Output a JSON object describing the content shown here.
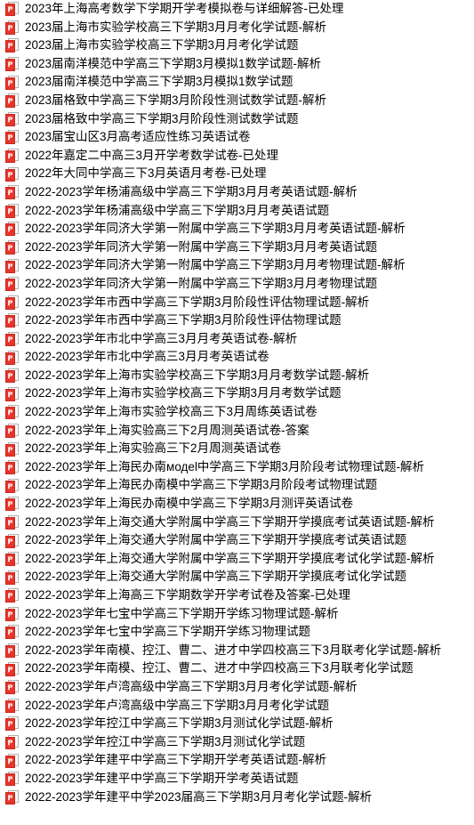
{
  "page": {
    "background_color": "#ffffff",
    "text_color": "#000000",
    "icon_color": "#e8342a",
    "icon_outline_color": "#a8a8a8",
    "icon_name": "pdf-document-icon"
  },
  "file_list": {
    "items": [
      {
        "label": "2023年上海高考数学下学期开学考模拟卷与详细解答-已处理"
      },
      {
        "label": "2023届上海市实验学校高三下学期3月月考化学试题-解析"
      },
      {
        "label": "2023届上海市实验学校高三下学期3月月考化学试题"
      },
      {
        "label": "2023届南洋模范中学高三下学期3月模拟1数学试题-解析"
      },
      {
        "label": "2023届南洋模范中学高三下学期3月模拟1数学试题"
      },
      {
        "label": "2023届格致中学高三下学期3月阶段性测试数学试题-解析"
      },
      {
        "label": "2023届格致中学高三下学期3月阶段性测试数学试题"
      },
      {
        "label": "2023届宝山区3月高考适应性练习英语试卷"
      },
      {
        "label": "2022年嘉定二中高三3月开学考数学试卷-已处理"
      },
      {
        "label": "2022年大同中学高三下3月英语月考卷-已处理"
      },
      {
        "label": "2022-2023学年杨浦高级中学高三下学期3月月考英语试题-解析"
      },
      {
        "label": "2022-2023学年杨浦高级中学高三下学期3月月考英语试题"
      },
      {
        "label": "2022-2023学年同济大学第一附属中学高三下学期3月月考英语试题-解析"
      },
      {
        "label": "2022-2023学年同济大学第一附属中学高三下学期3月月考英语试题"
      },
      {
        "label": "2022-2023学年同济大学第一附属中学高三下学期3月月考物理试题-解析"
      },
      {
        "label": "2022-2023学年同济大学第一附属中学高三下学期3月月考物理试题"
      },
      {
        "label": "2022-2023学年市西中学高三下学期3月阶段性评估物理试题-解析"
      },
      {
        "label": "2022-2023学年市西中学高三下学期3月阶段性评估物理试题"
      },
      {
        "label": "2022-2023学年市北中学高三3月月考英语试卷-解析"
      },
      {
        "label": "2022-2023学年市北中学高三3月月考英语试卷"
      },
      {
        "label": "2022-2023学年上海市实验学校高三下学期3月月考数学试题-解析"
      },
      {
        "label": "2022-2023学年上海市实验学校高三下学期3月月考数学试题"
      },
      {
        "label": "2022-2023学年上海市实验学校高三下3月周练英语试卷"
      },
      {
        "label": "2022-2023学年上海实验高三下2月周测英语试卷-答案"
      },
      {
        "label": "2022-2023学年上海实验高三下2月周测英语试卷"
      },
      {
        "label": "2022-2023学年上海民办南модel中学高三下学期3月阶段考试物理试题-解析"
      },
      {
        "label": "2022-2023学年上海民办南模中学高三下学期3月阶段考试物理试题"
      },
      {
        "label": "2022-2023学年上海民办南模中学高三下学期3月测评英语试卷"
      },
      {
        "label": "2022-2023学年上海交通大学附属中学高三下学期开学摸底考试英语试题-解析"
      },
      {
        "label": "2022-2023学年上海交通大学附属中学高三下学期开学摸底考试英语试题"
      },
      {
        "label": "2022-2023学年上海交通大学附属中学高三下学期开学摸底考试化学试题-解析"
      },
      {
        "label": "2022-2023学年上海交通大学附属中学高三下学期开学摸底考试化学试题"
      },
      {
        "label": "2022-2023学年上海高三下学期数学开学考试卷及答案-已处理"
      },
      {
        "label": "2022-2023学年七宝中学高三下学期开学练习物理试题-解析"
      },
      {
        "label": "2022-2023学年七宝中学高三下学期开学练习物理试题"
      },
      {
        "label": "2022-2023学年南模、控江、曹二、进才中学四校高三下3月联考化学试题-解析"
      },
      {
        "label": "2022-2023学年南模、控江、曹二、进才中学四校高三下3月联考化学试题"
      },
      {
        "label": "2022-2023学年卢湾高级中学高三下学期3月月考化学试题-解析"
      },
      {
        "label": "2022-2023学年卢湾高级中学高三下学期3月月考化学试题"
      },
      {
        "label": "2022-2023学年控江中学高三下学期3月测试化学试题-解析"
      },
      {
        "label": "2022-2023学年控江中学高三下学期3月测试化学试题"
      },
      {
        "label": "2022-2023学年建平中学高三下学期开学考英语试题-解析"
      },
      {
        "label": "2022-2023学年建平中学高三下学期开学考英语试题"
      },
      {
        "label": "2022-2023学年建平中学2023届高三下学期3月月考化学试题-解析"
      }
    ]
  }
}
